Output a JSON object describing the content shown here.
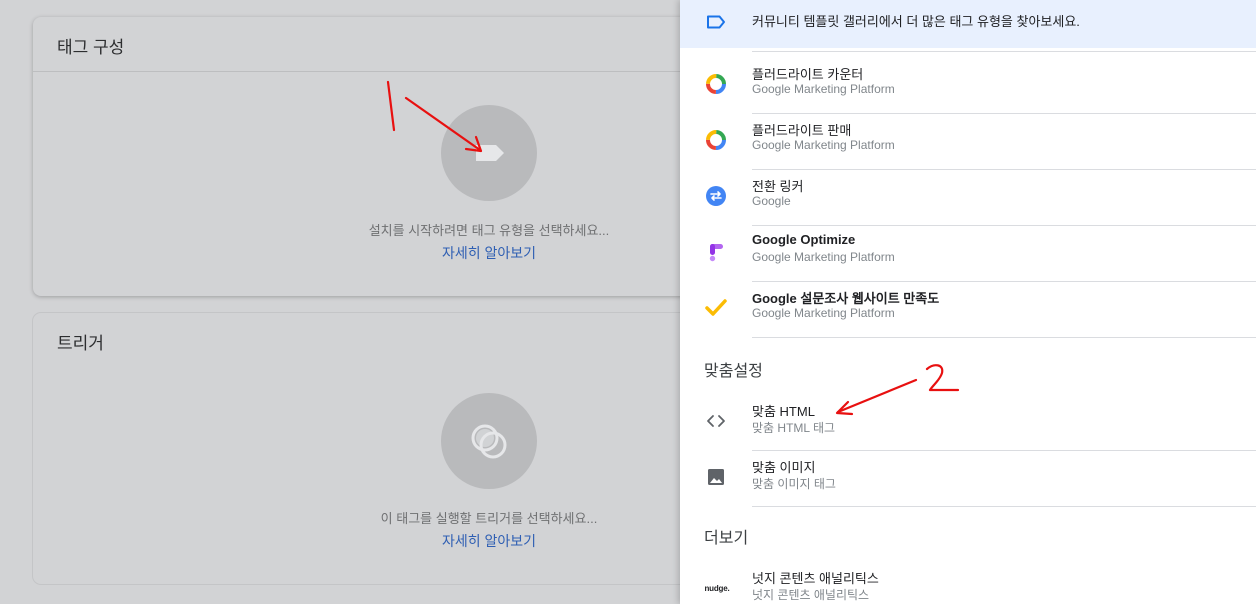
{
  "workspace": {
    "tag_card": {
      "title": "태그 구성",
      "hint": "설치를 시작하려면 태그 유형을 선택하세요...",
      "learn_more": "자세히 알아보기"
    },
    "trigger_card": {
      "title": "트리거",
      "hint": "이 태그를 실행할 트리거를 선택하세요...",
      "learn_more": "자세히 알아보기"
    }
  },
  "panel": {
    "banner_text": "커뮤니티 템플릿 갤러리에서 더 많은 태그 유형을 찾아보세요.",
    "featured_items": [
      {
        "name": "플러드라이트 카운터",
        "sub": "Google Marketing Platform",
        "icon": "floodlight-icon"
      },
      {
        "name": "플러드라이트 판매",
        "sub": "Google Marketing Platform",
        "icon": "floodlight-icon"
      },
      {
        "name": "전환 링커",
        "sub": "Google",
        "icon": "conversion-linker-icon"
      },
      {
        "name": "Google Optimize",
        "sub": "Google Marketing Platform",
        "icon": "optimize-icon"
      },
      {
        "name": "Google 설문조사 웹사이트 만족도",
        "sub": "Google Marketing Platform",
        "icon": "surveys-checkmark-icon"
      }
    ],
    "custom_section": {
      "title": "맞춤설정",
      "items": [
        {
          "name": "맞춤 HTML",
          "sub": "맞춤 HTML 태그",
          "icon": "code-brackets-icon"
        },
        {
          "name": "맞춤 이미지",
          "sub": "맞춤 이미지 태그",
          "icon": "image-icon"
        }
      ]
    },
    "more_section": {
      "title": "더보기",
      "items": [
        {
          "name": "넛지 콘텐츠 애널리틱스",
          "sub": "넛지 콘텐츠 애널리틱스",
          "icon_text": "nudge."
        }
      ]
    }
  },
  "annotations": {
    "label_1": "1",
    "label_2": "2",
    "color": "#e81010"
  }
}
